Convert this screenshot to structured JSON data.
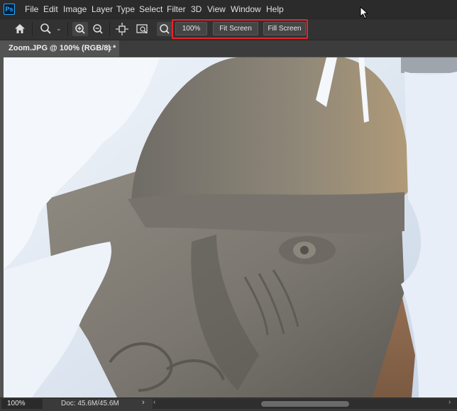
{
  "app": {
    "logo_text": "Ps"
  },
  "menu": [
    "File",
    "Edit",
    "Image",
    "Layer",
    "Type",
    "Select",
    "Filter",
    "3D",
    "View",
    "Window",
    "Help"
  ],
  "options_bar": {
    "zoom_100_label": "100%",
    "fit_screen_label": "Fit Screen",
    "fill_screen_label": "Fill Screen",
    "tools": [
      "home-icon",
      "zoom-icon",
      "zoom-in-icon",
      "zoom-out-icon",
      "resize-windows-icon",
      "zoom-all-windows-icon",
      "scrubby-zoom-icon"
    ]
  },
  "tabs": [
    {
      "label": "Zoom.JPG @ 100% (RGB/8) *",
      "close": "×"
    }
  ],
  "status": {
    "zoom": "100%",
    "doc_info": "Doc: 45.6M/45.6M",
    "arrow": "›"
  },
  "colors": {
    "highlight": "#e8232a",
    "menubar_bg": "#2b2b2b",
    "options_bg": "#323232",
    "workspace_bg": "#535353"
  }
}
